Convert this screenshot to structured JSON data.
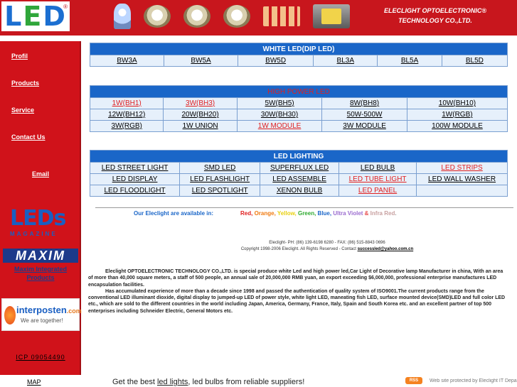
{
  "header": {
    "logo_letters": [
      "L",
      "E",
      "D"
    ],
    "logo_reg": "®",
    "company_line1": "ELECLIGHT  OPTOELECTRONIC®",
    "company_line2": "TECHNOLOGY CO.,LTD.",
    "colors": {
      "band": "#c8161d",
      "logo_blue": "#1b6fd1",
      "logo_green": "#2fa63a"
    }
  },
  "sidebar": {
    "links": [
      "Profil",
      "Products",
      "Service",
      "Contact Us",
      "Email"
    ],
    "leds_magazine": {
      "title": "LEDs",
      "subtitle": "MAGAZINE"
    },
    "maxim": {
      "logo": "MAXIM",
      "label_line1": "Maxim Integrated",
      "label_line2": "Products"
    },
    "interposten": {
      "name": "interposten",
      "suffix": ".com",
      "tagline": "We are together!"
    },
    "icp": "ICP  09054490"
  },
  "white_led": {
    "title": "WHITE LED(DIP LED)",
    "items": [
      "BW3A",
      "BW5A",
      "BW5D",
      "BL3A",
      "BL5A",
      "BL5D"
    ]
  },
  "high_power": {
    "title": "HIGH POWER LED",
    "rows": [
      [
        "1W(BH1)",
        "3W(BH3)",
        "5W(BH5)",
        "8W(BH8)",
        "10W(BH10)"
      ],
      [
        "12W(BH12)",
        "20W(BH20)",
        "30W(BH30)",
        "50W-500W",
        "1W(RGB)"
      ],
      [
        "3W(RGB)",
        "1W UNION",
        "1W MODULE",
        "3W MODULE",
        "100W MODULE"
      ]
    ]
  },
  "lighting": {
    "title": "LED LIGHTING",
    "rows": [
      [
        "LED STREET LIGHT",
        "SMD LED",
        "SUPERFLUX LED",
        "LED BULB",
        "LED STRIPS"
      ],
      [
        "LED DISPLAY",
        "LED FLASHLIGHT",
        "LED ASSEMBLE",
        "LED TUBE LIGHT",
        "LED WALL WASHER"
      ],
      [
        "LED FLOODLIGHT",
        "LED SPOTLIGHT",
        "XENON BULB",
        "LED PANEL",
        ""
      ]
    ]
  },
  "availability": {
    "label": "Our Eleclight are available in:",
    "colors": [
      {
        "text": "Red",
        "color": "#e02020"
      },
      {
        "text": ", ",
        "color": "#e02020"
      },
      {
        "text": "Orange",
        "color": "#f07a10"
      },
      {
        "text": ", ",
        "color": "#f07a10"
      },
      {
        "text": "Yellow",
        "color": "#e8d010"
      },
      {
        "text": ", ",
        "color": "#e8d010"
      },
      {
        "text": "Green",
        "color": "#2faa30"
      },
      {
        "text": ", ",
        "color": "#2faa30"
      },
      {
        "text": "Blue",
        "color": "#1a66c8"
      },
      {
        "text": ", ",
        "color": "#1a66c8"
      },
      {
        "text": "Ultra Violet",
        "color": "#9b6ccf"
      },
      {
        "text": " & ",
        "color": "#e85050"
      },
      {
        "text": "Infra Red",
        "color": "#c8a0a0"
      },
      {
        "text": ".",
        "color": "#999"
      }
    ]
  },
  "contact": {
    "phones": "Eleclight- PH: (86) 139-6198 6280 - FAX: (86) 515-8843 0696",
    "copyright": "Copyright 1998-2006 Eleclight. All Rights Reserved - Contact",
    "email": "successled@yahoo.com.cn"
  },
  "about": {
    "p1": "Eleclight OPTOELECTRONIC TECHNOLOGY CO.,LTD.  is special produce white Led and high power led,Car Light of Decorative lamp Manufacturer in china, With an area of more than 40,000 square meters, a staff of 500 people, an annual sale of 20,000,000 RMB yuan, an export exceeding $6,000,000, professional enterprise manufactures LED encapsulation facilities.",
    "p2": "Has accumulated experience of more than a decade since 1998 and passed the authentication of quality system of ISO9001.The current products range from the conventional LED illuminant dioxide, digital display to jumped-up LED of power style, white light LED, maneating fish LED, surface mounted device(SMD)LED and full color LED etc., which are sold to the different countries in the world including Japan, America, Germany, France, Italy, Spain and South Korea etc. and an excellent partner of top 500 enterprises including Schneider Electric, General Motors  etc."
  },
  "footer": {
    "map": "MAP",
    "text_before": "Get the best ",
    "link": "led lights",
    "text_after": ", led bulbs from reliable suppliers!",
    "rss": "RSS",
    "protected": "Web site protected by Eleclight IT Department"
  }
}
